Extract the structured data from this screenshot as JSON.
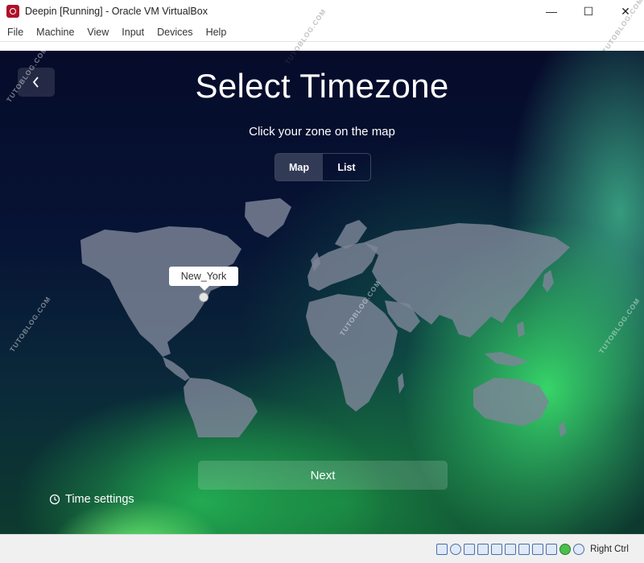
{
  "window": {
    "title": "Deepin [Running] - Oracle VM VirtualBox",
    "controls": {
      "minimize": "—",
      "maximize": "☐",
      "close": "✕"
    }
  },
  "menu": [
    "File",
    "Machine",
    "View",
    "Input",
    "Devices",
    "Help"
  ],
  "installer": {
    "title": "Select Timezone",
    "subtitle": "Click your zone on the map",
    "tabs": [
      {
        "label": "Map",
        "active": true
      },
      {
        "label": "List",
        "active": false
      }
    ],
    "selected_zone": "New_York",
    "next_label": "Next",
    "time_settings_label": "Time settings"
  },
  "watermark": "TUTOBLOG.COM",
  "statusbar": {
    "host_key": "Right Ctrl",
    "icons": [
      "hard-disk-icon",
      "optical-drive-icon",
      "audio-icon",
      "network-icon",
      "usb-icon",
      "shared-folders-icon",
      "display-icon",
      "recording-icon",
      "capture-icon",
      "mouse-integration-icon",
      "arrow-down-icon"
    ]
  },
  "colors": {
    "accent": "#b0102a",
    "night_sky": "#071435",
    "aurora": "#3ce66e"
  }
}
